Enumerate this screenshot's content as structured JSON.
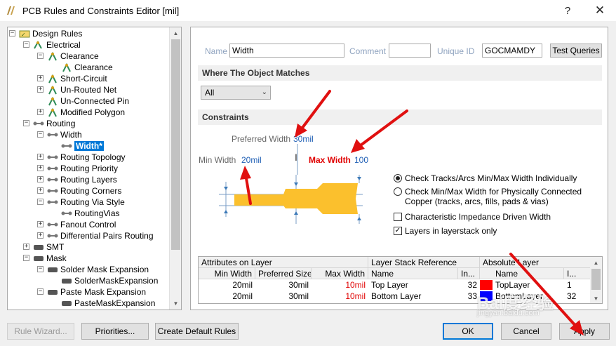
{
  "window": {
    "title": "PCB Rules and Constraints Editor [mil]",
    "help_glyph": "?",
    "close_glyph": "✕"
  },
  "tree": {
    "items": [
      {
        "label": "Design Rules",
        "level": 0,
        "expander": "-",
        "icon": "rules-root-icon"
      },
      {
        "label": "Electrical",
        "level": 1,
        "expander": "-",
        "icon": "electrical-icon"
      },
      {
        "label": "Clearance",
        "level": 2,
        "expander": "-",
        "icon": "rule-icon"
      },
      {
        "label": "Clearance",
        "level": 3,
        "expander": "",
        "icon": "rule-icon"
      },
      {
        "label": "Short-Circuit",
        "level": 2,
        "expander": "+",
        "icon": "rule-icon"
      },
      {
        "label": "Un-Routed Net",
        "level": 2,
        "expander": "+",
        "icon": "rule-icon"
      },
      {
        "label": "Un-Connected Pin",
        "level": 2,
        "expander": "",
        "icon": "rule-icon"
      },
      {
        "label": "Modified Polygon",
        "level": 2,
        "expander": "+",
        "icon": "rule-icon"
      },
      {
        "label": "Routing",
        "level": 1,
        "expander": "-",
        "icon": "routing-icon"
      },
      {
        "label": "Width",
        "level": 2,
        "expander": "-",
        "icon": "routing-icon"
      },
      {
        "label": "Width*",
        "level": 3,
        "expander": "",
        "icon": "routing-icon",
        "selected": true
      },
      {
        "label": "Routing Topology",
        "level": 2,
        "expander": "+",
        "icon": "routing-icon"
      },
      {
        "label": "Routing Priority",
        "level": 2,
        "expander": "+",
        "icon": "routing-icon"
      },
      {
        "label": "Routing Layers",
        "level": 2,
        "expander": "+",
        "icon": "routing-icon"
      },
      {
        "label": "Routing Corners",
        "level": 2,
        "expander": "+",
        "icon": "routing-icon"
      },
      {
        "label": "Routing Via Style",
        "level": 2,
        "expander": "-",
        "icon": "routing-icon"
      },
      {
        "label": "RoutingVias",
        "level": 3,
        "expander": "",
        "icon": "routing-icon"
      },
      {
        "label": "Fanout Control",
        "level": 2,
        "expander": "+",
        "icon": "routing-icon"
      },
      {
        "label": "Differential Pairs Routing",
        "level": 2,
        "expander": "+",
        "icon": "routing-icon"
      },
      {
        "label": "SMT",
        "level": 1,
        "expander": "+",
        "icon": "smt-icon"
      },
      {
        "label": "Mask",
        "level": 1,
        "expander": "-",
        "icon": "mask-icon"
      },
      {
        "label": "Solder Mask Expansion",
        "level": 2,
        "expander": "-",
        "icon": "mask-icon"
      },
      {
        "label": "SolderMaskExpansion",
        "level": 3,
        "expander": "",
        "icon": "mask-icon"
      },
      {
        "label": "Paste Mask Expansion",
        "level": 2,
        "expander": "-",
        "icon": "mask-icon"
      },
      {
        "label": "PasteMaskExpansion",
        "level": 3,
        "expander": "",
        "icon": "mask-icon"
      }
    ]
  },
  "rule": {
    "name_label": "Name",
    "name_value": "Width",
    "comment_label": "Comment",
    "comment_value": "",
    "unique_id_label": "Unique ID",
    "unique_id_value": "GOCMAMDY",
    "test_queries_label": "Test Queries"
  },
  "where": {
    "header": "Where The Object Matches",
    "dropdown_value": "All"
  },
  "constraints": {
    "header": "Constraints",
    "preferred_label": "Preferred Width",
    "preferred_value": "30mil",
    "min_label": "Min Width",
    "min_value": "20mil",
    "max_label": "Max Width",
    "max_value": "100",
    "options": {
      "radio1": "Check Tracks/Arcs Min/Max Width Individually",
      "radio2_line1": "Check Min/Max Width for Physically Connected",
      "radio2_line2": "Copper (tracks, arcs, fills, pads & vias)",
      "check1": "Characteristic Impedance Driven Width",
      "check2": "Layers in layerstack only"
    }
  },
  "table": {
    "group_headers": [
      "Attributes on Layer",
      "Layer Stack Reference",
      "Absolute Layer"
    ],
    "columns": [
      "Min Width",
      "Preferred Size",
      "Max Width",
      "Name",
      "In...",
      "Name",
      "I..."
    ],
    "rows": [
      {
        "min": "20mil",
        "pref": "30mil",
        "max": "10mil",
        "stack_name": "Top Layer",
        "index": "32",
        "abs_name": "TopLayer",
        "abs_index": "1"
      },
      {
        "min": "20mil",
        "pref": "30mil",
        "max": "10mil",
        "stack_name": "Bottom Layer",
        "index": "33",
        "abs_name": "BottomLayer",
        "abs_index": "32"
      }
    ]
  },
  "buttons": {
    "rule_wizard": "Rule Wizard...",
    "priorities": "Priorities...",
    "create_default": "Create Default Rules",
    "ok": "OK",
    "cancel": "Cancel",
    "apply": "Apply"
  },
  "watermark": {
    "logo": "Bai度经验",
    "url": "jingyan.baidu.com"
  },
  "colors": {
    "selection": "#0078d7",
    "track": "#fbc02d",
    "red_value": "#e00000",
    "blue_value": "#1f5fb5",
    "annotation_arrow": "#e01010",
    "top_layer": "#ff0000",
    "bottom_layer": "#0000ff"
  }
}
